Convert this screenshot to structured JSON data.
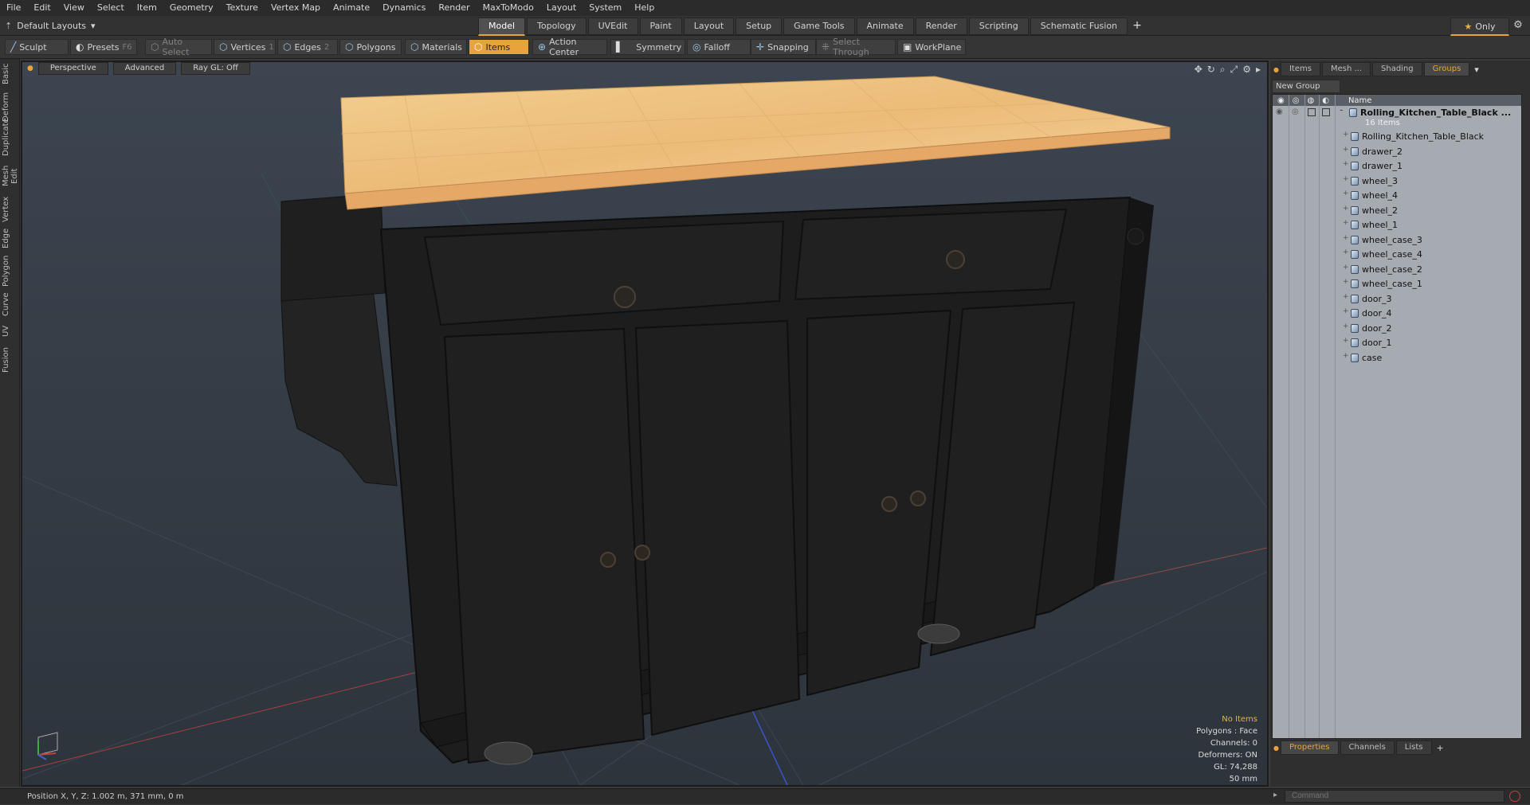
{
  "menubar": [
    "File",
    "Edit",
    "View",
    "Select",
    "Item",
    "Geometry",
    "Texture",
    "Vertex Map",
    "Animate",
    "Dynamics",
    "Render",
    "MaxToModo",
    "Layout",
    "System",
    "Help"
  ],
  "layout": {
    "label": "Default Layouts"
  },
  "tabs": [
    {
      "label": "Model",
      "active": true
    },
    {
      "label": "Topology"
    },
    {
      "label": "UVEdit"
    },
    {
      "label": "Paint"
    },
    {
      "label": "Layout"
    },
    {
      "label": "Setup"
    },
    {
      "label": "Game Tools"
    },
    {
      "label": "Animate"
    },
    {
      "label": "Render"
    },
    {
      "label": "Scripting"
    },
    {
      "label": "Schematic Fusion"
    }
  ],
  "only_label": "Only",
  "toolbar": {
    "sculpt": "Sculpt",
    "presets": "Presets",
    "presets_key": "F6",
    "auto_select": "Auto Select",
    "vertices": "Vertices",
    "vertices_key": "1",
    "edges": "Edges",
    "edges_key": "2",
    "polygons": "Polygons",
    "materials": "Materials",
    "items": "Items",
    "action_center": "Action Center",
    "symmetry": "Symmetry",
    "falloff": "Falloff",
    "snapping": "Snapping",
    "select_through": "Select Through",
    "workplane": "WorkPlane"
  },
  "left_strip": [
    "Basic",
    "Deform",
    "Duplicate",
    "Mesh Edit",
    "Vertex",
    "Edge",
    "Polygon",
    "Curve",
    "UV",
    "Fusion"
  ],
  "viewport": {
    "view": "Perspective",
    "shading": "Advanced",
    "raygl": "Ray GL: Off",
    "hud": {
      "items": "No Items",
      "polygons": "Polygons : Face",
      "channels": "Channels: 0",
      "deformers": "Deformers: ON",
      "gl": "GL: 74,288",
      "distance": "50 mm"
    }
  },
  "panel": {
    "tabs": [
      {
        "label": "Items"
      },
      {
        "label": "Mesh ..."
      },
      {
        "label": "Shading"
      },
      {
        "label": "Groups",
        "active": true
      }
    ],
    "new_group": "New Group",
    "name_header": "Name",
    "root": "Rolling_Kitchen_Table_Black ...",
    "root_count": "16 Items",
    "items": [
      "Rolling_Kitchen_Table_Black",
      "drawer_2",
      "drawer_1",
      "wheel_3",
      "wheel_4",
      "wheel_2",
      "wheel_1",
      "wheel_case_3",
      "wheel_case_4",
      "wheel_case_2",
      "wheel_case_1",
      "door_3",
      "door_4",
      "door_2",
      "door_1",
      "case"
    ],
    "bottom_tabs": [
      {
        "label": "Properties",
        "active": true
      },
      {
        "label": "Channels"
      },
      {
        "label": "Lists"
      }
    ]
  },
  "status": {
    "position": "Position X, Y, Z:  1.002 m, 371 mm, 0 m",
    "command_placeholder": "Command"
  }
}
